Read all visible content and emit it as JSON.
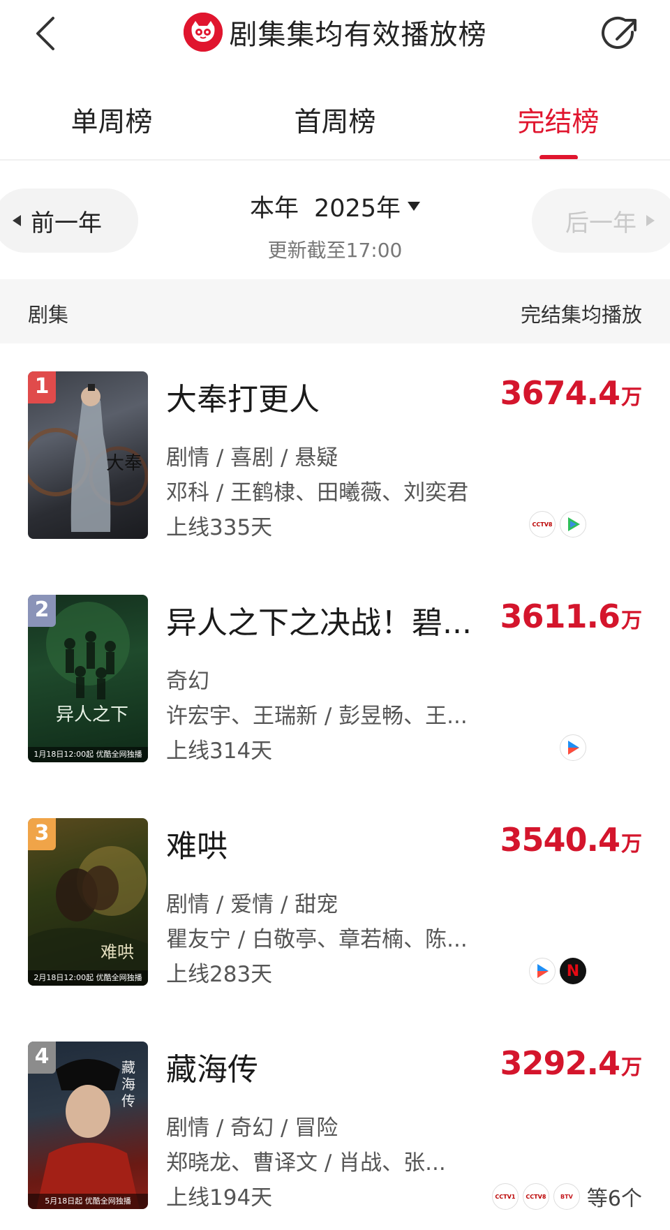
{
  "header": {
    "title": "剧集集均有效播放榜"
  },
  "tabs": [
    {
      "label": "单周榜"
    },
    {
      "label": "首周榜"
    },
    {
      "label": "完结榜"
    }
  ],
  "active_tab": "完结榜",
  "year_nav": {
    "prev_label": "前一年",
    "current_label": "本年",
    "current_year": "2025年",
    "next_label": "后一年",
    "update_time": "更新截至17:00"
  },
  "list_header": {
    "left": "剧集",
    "right": "完结集均播放"
  },
  "items": [
    {
      "rank": "1",
      "title": "大奉打更人",
      "plays": "3674.4",
      "unit": "万",
      "genre": "剧情 / 喜剧 / 悬疑",
      "cast": "邓科 / 王鹤棣、田曦薇、刘奕君",
      "online": "上线335天",
      "platforms": [
        "CCTV-8 电视剧",
        "腾讯视频"
      ],
      "more_platforms": "",
      "rank_color": "#e04b4b"
    },
    {
      "rank": "2",
      "title": "异人之下之决战！碧...",
      "plays": "3611.6",
      "unit": "万",
      "genre": "奇幻",
      "cast": "许宏宇、王瑞新 / 彭昱畅、王...",
      "online": "上线314天",
      "platforms": [
        "优酷"
      ],
      "more_platforms": "",
      "poster_caption": "1月18日12:00起 优酷全网独播",
      "rank_color": "#8a93b8"
    },
    {
      "rank": "3",
      "title": "难哄",
      "plays": "3540.4",
      "unit": "万",
      "genre": "剧情 / 爱情 / 甜宠",
      "cast": "瞿友宁 / 白敬亭、章若楠、陈...",
      "online": "上线283天",
      "platforms": [
        "优酷",
        "Netflix"
      ],
      "more_platforms": "",
      "poster_caption": "2月18日12:00起 优酷全网独播",
      "rank_color": "#f0a448"
    },
    {
      "rank": "4",
      "title": "藏海传",
      "plays": "3292.4",
      "unit": "万",
      "genre": "剧情 / 奇幻 / 冒险",
      "cast": "郑晓龙、曹译文 / 肖战、张...",
      "online": "上线194天",
      "platforms": [
        "CCTV-1 综合",
        "CCTV-8 电视剧",
        "BTV 北京"
      ],
      "more_platforms": "等6个",
      "poster_caption": "5月18日起 优酷全网独播",
      "rank_color": "#8c8c8c"
    }
  ],
  "colors": {
    "accent": "#e0152e",
    "plays": "#d4152c"
  }
}
